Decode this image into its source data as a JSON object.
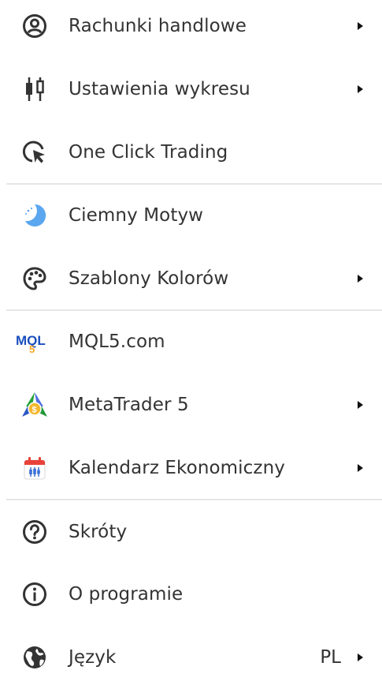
{
  "menu": {
    "items": [
      {
        "label": "Rachunki handlowe",
        "icon": "account-icon",
        "has_submenu": true
      },
      {
        "label": "Ustawienia wykresu",
        "icon": "candlestick-chart-icon",
        "has_submenu": true
      },
      {
        "label": "One Click Trading",
        "icon": "one-click-cursor-icon",
        "has_submenu": false
      },
      {
        "label": "Ciemny Motyw",
        "icon": "moon-icon",
        "has_submenu": false
      },
      {
        "label": "Szablony Kolorów",
        "icon": "palette-icon",
        "has_submenu": true
      },
      {
        "label": "MQL5.com",
        "icon": "mql5-logo-icon",
        "has_submenu": false
      },
      {
        "label": "MetaTrader 5",
        "icon": "metatrader5-logo-icon",
        "has_submenu": true
      },
      {
        "label": "Kalendarz Ekonomiczny",
        "icon": "calendar-icon",
        "has_submenu": true
      },
      {
        "label": "Skróty",
        "icon": "question-icon",
        "has_submenu": false
      },
      {
        "label": "O programie",
        "icon": "info-icon",
        "has_submenu": false
      },
      {
        "label": "Język",
        "icon": "globe-icon",
        "has_submenu": true,
        "value": "PL"
      }
    ]
  },
  "colors": {
    "text": "#333333",
    "divider": "#e6e6e6",
    "moon": "#5aa7f0",
    "mql5_blue": "#1b4fbd",
    "mql5_orange": "#f6a623",
    "calendar_red": "#e8423a",
    "calendar_blue": "#3d6fd6"
  }
}
